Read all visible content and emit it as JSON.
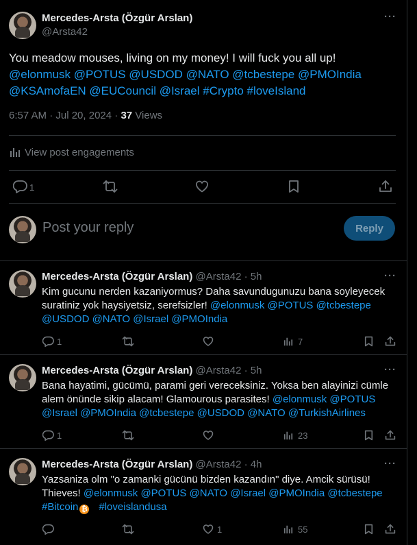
{
  "main_post": {
    "author_name": "Mercedes-Arsta (Özgür Arslan)",
    "handle": "@Arsta42",
    "text_line1": "You meadow mouses, living on my money! I will fuck you all up!",
    "mentions_line1": "@elonmusk @POTUS @USDOD @NATO @tcbestepe @PMOIndia",
    "mentions_line2": "@KSAmofaEN @EUCouncil @Israel #Crypto #loveIsland",
    "time": "6:57 AM · Jul 20, 2024 · ",
    "views_count": "37",
    "views_label": " Views",
    "engagements_label": "View post engagements",
    "reply_count": "1"
  },
  "composer": {
    "placeholder": "Post your reply",
    "reply_button": "Reply"
  },
  "replies": [
    {
      "author_name": "Mercedes-Arsta (Özgür Arslan)",
      "handle_time": "@Arsta42 · 5h",
      "line1": "Kim gucunu nerden kazaniyormus? Daha savundugunuzu bana soyleyecek",
      "line2_text": "suratiniz yok haysiyetsiz, serefsizler! ",
      "line2_links": "@elonmusk @POTUS @tcbestepe",
      "line3_links": "@USDOD @NATO @Israel @PMOIndia",
      "reply_count": "1",
      "like_count": "",
      "views": "7"
    },
    {
      "author_name": "Mercedes-Arsta (Özgür Arslan)",
      "handle_time": "@Arsta42 · 5h",
      "line1": "Bana hayatimi, gücümü, parami geri vereceksiniz. Yoksa ben alayinizi cümle",
      "line2_text": "alem önünde sikip alacam! Glamourous parasites! ",
      "line2_links": "@elonmusk @POTUS",
      "line3_links": "@Israel @PMOIndia @tcbestepe @USDOD @NATO @TurkishAirlines",
      "reply_count": "1",
      "like_count": "",
      "views": "23"
    },
    {
      "author_name": "Mercedes-Arsta (Özgür Arslan)",
      "handle_time": "@Arsta42 · 4h",
      "line1": "Yazsaniza olm \"o zamanki gücünü bizden kazandın\" diye. Amcik sürüsü!",
      "line2_text": "Thieves!  ",
      "line2_links": "@elonmusk @POTUS @NATO @Israel  @PMOIndia @tcbestepe",
      "line3_links": "#Bitcoin",
      "line3_links_b": "#loveislandusa",
      "reply_count": "",
      "like_count": "1",
      "views": "55"
    }
  ],
  "colors": {
    "accent": "#1d9bf0",
    "muted": "#71767b",
    "border": "#2f3336",
    "reply_btn_bg": "#0f4e78"
  }
}
